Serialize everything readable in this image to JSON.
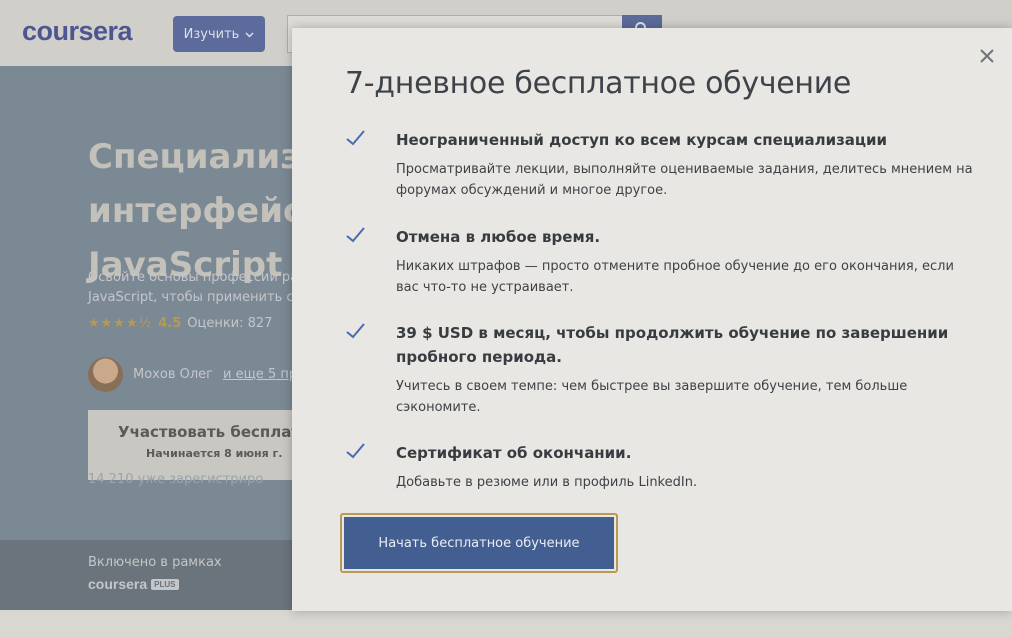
{
  "background": {
    "logo": "coursera",
    "explore_label": "Изучить",
    "hero_title": "Специализа\nинтерфейсо\nJavaScript",
    "hero_subtitle": "Освойте основы профессии ра\nJavaScript, чтобы применить с",
    "rating_stars": "★★★★½",
    "rating_value": "4.5",
    "rating_count": "Оценки: 827",
    "instructor_name": "Мохов Олег",
    "instructor_more": "и еще 5 пр",
    "enroll_title": "Участвовать бесплат",
    "enroll_date": "Начинается 8 июня г.",
    "enrolled_count": "14 210 уже зарегистриро",
    "included_label": "Включено в рамках",
    "plus_logo": "coursera",
    "plus_badge": "PLUS"
  },
  "modal": {
    "title": "7-дневное бесплатное обучение",
    "close_icon": "close-icon",
    "features": [
      {
        "title": "Неограниченный доступ ко всем курсам специализации",
        "description": "Просматривайте лекции, выполняйте оцениваемые задания, делитесь мнением на форумах обсуждений и многое другое."
      },
      {
        "title": "Отмена в любое время.",
        "description": "Никаких штрафов — просто отмените пробное обучение до его окончания, если вас что-то не устраивает."
      },
      {
        "title": "39 $ USD в месяц, чтобы продолжить обучение по завершении пробного периода.",
        "description": "Учитесь в своем темпе: чем быстрее вы завершите обучение, тем больше сэкономите."
      },
      {
        "title": "Сертификат об окончании.",
        "description": "Добавьте в резюме или в профиль LinkedIn."
      }
    ],
    "cta_label": "Начать бесплатное обучение"
  },
  "colors": {
    "accent": "#435f92",
    "check": "#4a6bb0",
    "cta_border": "#b89a55"
  }
}
